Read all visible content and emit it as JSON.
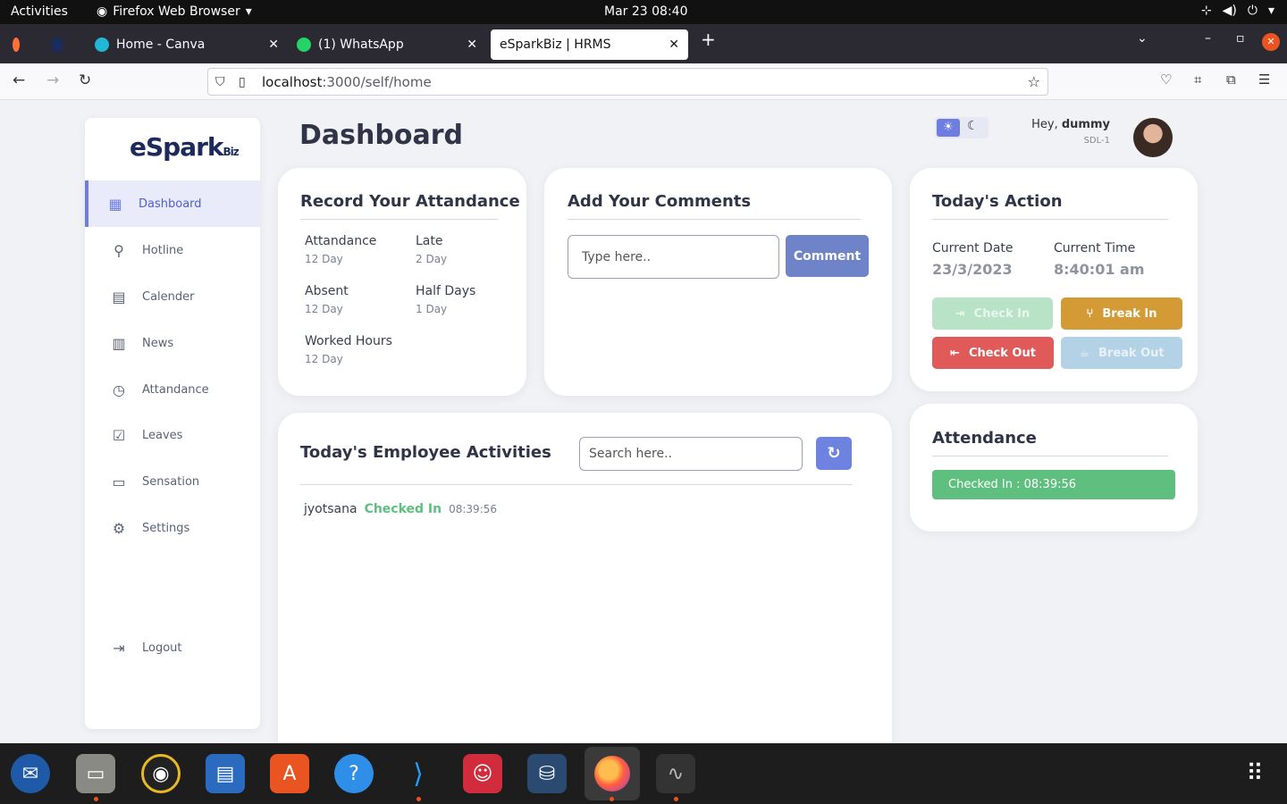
{
  "system": {
    "activities": "Activities",
    "app_name": "Firefox Web Browser",
    "clock": "Mar 23  08:40"
  },
  "browser": {
    "tabs": [
      {
        "label": "Home - Canva"
      },
      {
        "label": "(1) WhatsApp"
      },
      {
        "label": "eSparkBiz | HRMS"
      }
    ],
    "url_host": "localhost",
    "url_path": ":3000/self/home"
  },
  "sidebar": {
    "logo": "eSpark",
    "logo_small": "Biz",
    "items": [
      {
        "label": "Dashboard"
      },
      {
        "label": "Hotline"
      },
      {
        "label": "Calender"
      },
      {
        "label": "News"
      },
      {
        "label": "Attandance"
      },
      {
        "label": "Leaves"
      },
      {
        "label": "Sensation"
      },
      {
        "label": "Settings"
      }
    ],
    "logout": "Logout"
  },
  "header": {
    "title": "Dashboard",
    "greeting": "Hey,",
    "user": "dummy",
    "dept": "SDL-1"
  },
  "attendance_card": {
    "title": "Record Your Attandance",
    "stats": [
      {
        "label": "Attandance",
        "value": "12 Day"
      },
      {
        "label": "Late",
        "value": "2 Day"
      },
      {
        "label": "Absent",
        "value": "12 Day"
      },
      {
        "label": "Half Days",
        "value": "1 Day"
      },
      {
        "label": "Worked Hours",
        "value": "12 Day"
      }
    ]
  },
  "comments_card": {
    "title": "Add Your Comments",
    "placeholder": "Type here..",
    "button": "Comment"
  },
  "action_card": {
    "title": "Today's Action",
    "date_label": "Current Date",
    "date_value": "23/3/2023",
    "time_label": "Current Time",
    "time_value": "8:40:01 am",
    "check_in": "Check In",
    "break_in": "Break In",
    "check_out": "Check Out",
    "break_out": "Break Out"
  },
  "activities_card": {
    "title": "Today's Employee Activities",
    "search_placeholder": "Search here..",
    "rows": [
      {
        "name": "jyotsana",
        "status": "Checked In",
        "time": "08:39:56"
      }
    ]
  },
  "attendance_status": {
    "title": "Attendance",
    "status": "Checked In : 08:39:56"
  },
  "colors": {
    "accent": "#6e7de0",
    "success": "#5ebf7f",
    "warning": "#d39a35",
    "danger": "#e05a5a"
  }
}
